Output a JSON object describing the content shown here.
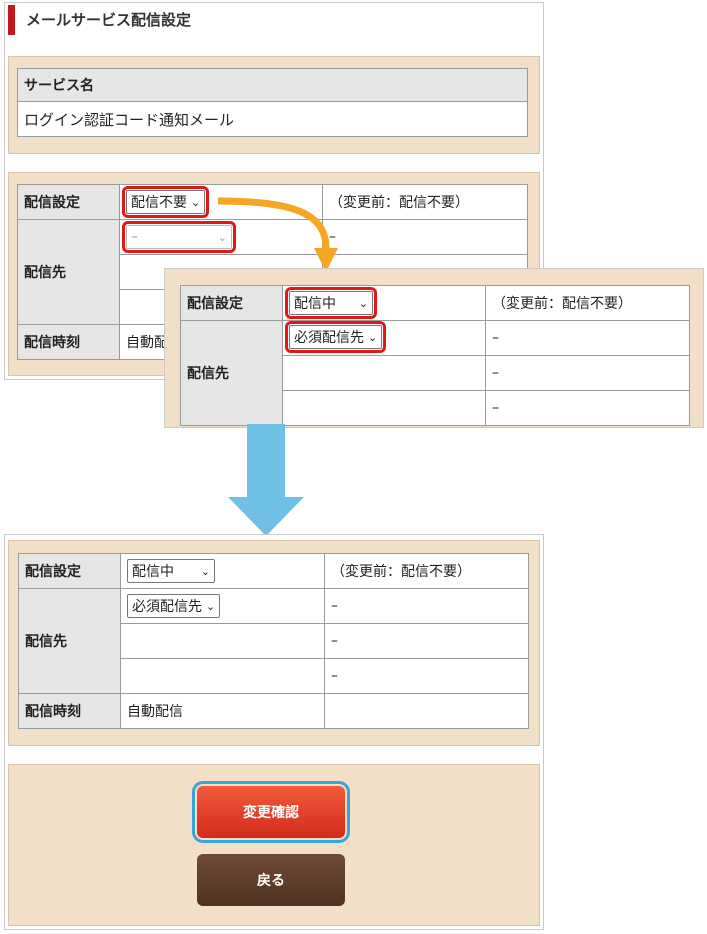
{
  "header": {
    "title": "メールサービス配信設定"
  },
  "service": {
    "header": "サービス名",
    "name": "ログイン認証コード通知メール"
  },
  "labels": {
    "delivery_setting": "配信設定",
    "recipient": "配信先",
    "delivery_time": "配信時刻"
  },
  "step1": {
    "delivery_value": "配信不要",
    "previous": "（変更前：配信不要）",
    "recipient_value": "–",
    "dash": "–",
    "time_value": "自動配"
  },
  "step2": {
    "delivery_value": "配信中",
    "previous": "（変更前：配信不要）",
    "recipient_value": "必須配信先",
    "dash": "–"
  },
  "final": {
    "delivery_value": "配信中",
    "previous": "（変更前：配信不要）",
    "recipient_value": "必須配信先",
    "dash": "–",
    "time_value": "自動配信"
  },
  "buttons": {
    "confirm": "変更確認",
    "back": "戻る"
  },
  "colors": {
    "highlight_red": "#e01818",
    "arrow_orange": "#f5a623",
    "arrow_blue": "#6ec1e4",
    "beige": "#f2dfc8"
  }
}
